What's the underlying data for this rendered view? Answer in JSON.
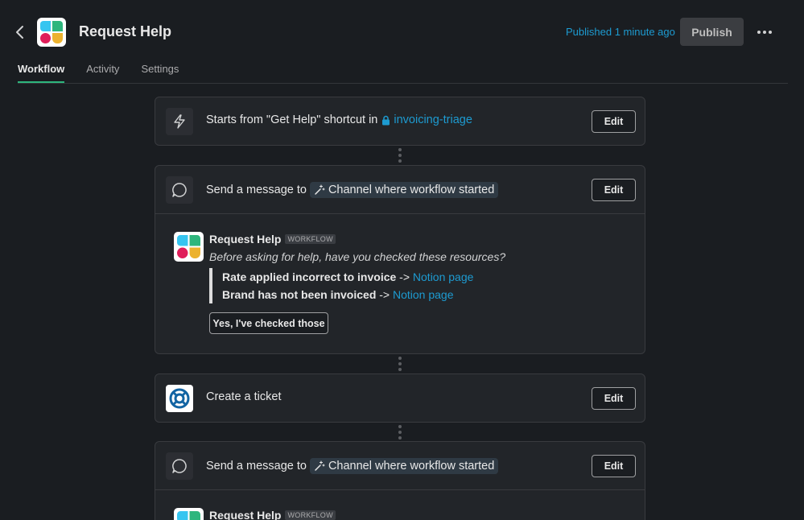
{
  "header": {
    "title": "Request Help",
    "published_text": "Published 1 minute ago",
    "publish_label": "Publish"
  },
  "tabs": [
    {
      "label": "Workflow",
      "active": true
    },
    {
      "label": "Activity",
      "active": false
    },
    {
      "label": "Settings",
      "active": false
    }
  ],
  "steps": [
    {
      "prefix": "Starts from \"Get Help\" shortcut in",
      "channel": "invoicing-triage",
      "edit_label": "Edit",
      "icon": "lightning-icon"
    },
    {
      "prefix": "Send a message to",
      "target": "Channel where workflow started",
      "edit_label": "Edit",
      "icon": "message-bubble-icon",
      "preview": {
        "name": "Request Help",
        "badge": "WORKFLOW",
        "intro": "Before asking for help, have you checked these resources?",
        "lines": [
          {
            "bold": "Rate applied incorrect to invoice",
            "arrow": " -> ",
            "link": "Notion page"
          },
          {
            "bold": "Brand has not been invoiced",
            "arrow": " -> ",
            "link": "Notion page"
          }
        ],
        "button": "Yes, I've checked those"
      }
    },
    {
      "prefix": "Create a ticket",
      "edit_label": "Edit",
      "icon": "lifebuoy-icon"
    },
    {
      "prefix": "Send a message to",
      "target": "Channel where workflow started",
      "edit_label": "Edit",
      "icon": "message-bubble-icon",
      "preview": {
        "name": "Request Help",
        "badge": "WORKFLOW"
      }
    }
  ],
  "colors": {
    "background": "#1a1d21",
    "card": "#222529",
    "link": "#1d9bd1",
    "active_tab": "#2eb67d"
  }
}
